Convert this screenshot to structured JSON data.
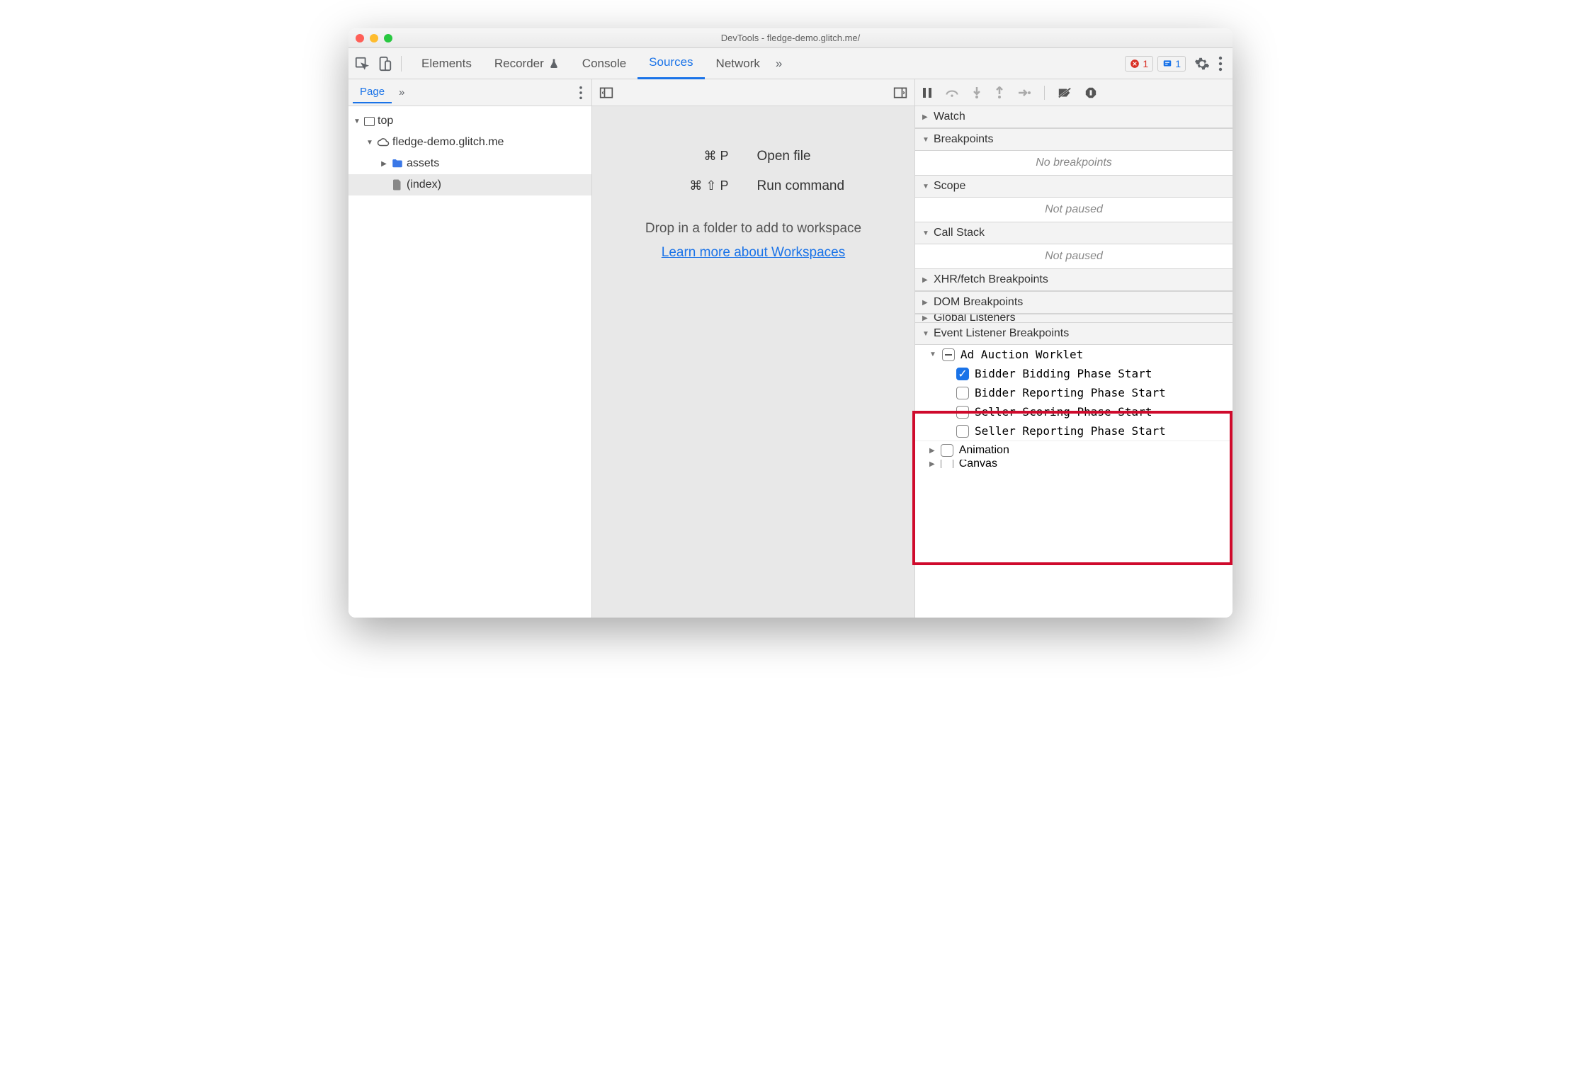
{
  "window": {
    "title": "DevTools - fledge-demo.glitch.me/"
  },
  "tabs": {
    "items": [
      "Elements",
      "Recorder",
      "Console",
      "Sources",
      "Network"
    ],
    "active": "Sources",
    "error_count": "1",
    "message_count": "1"
  },
  "left": {
    "page_tab": "Page",
    "tree": {
      "top": "top",
      "origin": "fledge-demo.glitch.me",
      "folder": "assets",
      "file": "(index)"
    }
  },
  "center": {
    "open_file_keys": "⌘ P",
    "open_file_label": "Open file",
    "run_cmd_keys": "⌘ ⇧ P",
    "run_cmd_label": "Run command",
    "drop_text": "Drop in a folder to add to workspace",
    "learn_more": "Learn more about Workspaces"
  },
  "right": {
    "sections": {
      "watch": "Watch",
      "breakpoints": "Breakpoints",
      "breakpoints_empty": "No breakpoints",
      "scope": "Scope",
      "scope_empty": "Not paused",
      "callstack": "Call Stack",
      "callstack_empty": "Not paused",
      "xhr": "XHR/fetch Breakpoints",
      "dom": "DOM Breakpoints",
      "global": "Global Listeners",
      "elb": "Event Listener Breakpoints",
      "animation": "Animation",
      "canvas": "Canvas"
    },
    "elb_category": "Ad Auction Worklet",
    "elb_items": [
      {
        "label": "Bidder Bidding Phase Start",
        "checked": true
      },
      {
        "label": "Bidder Reporting Phase Start",
        "checked": false
      },
      {
        "label": "Seller Scoring Phase Start",
        "checked": false
      },
      {
        "label": "Seller Reporting Phase Start",
        "checked": false
      }
    ]
  }
}
